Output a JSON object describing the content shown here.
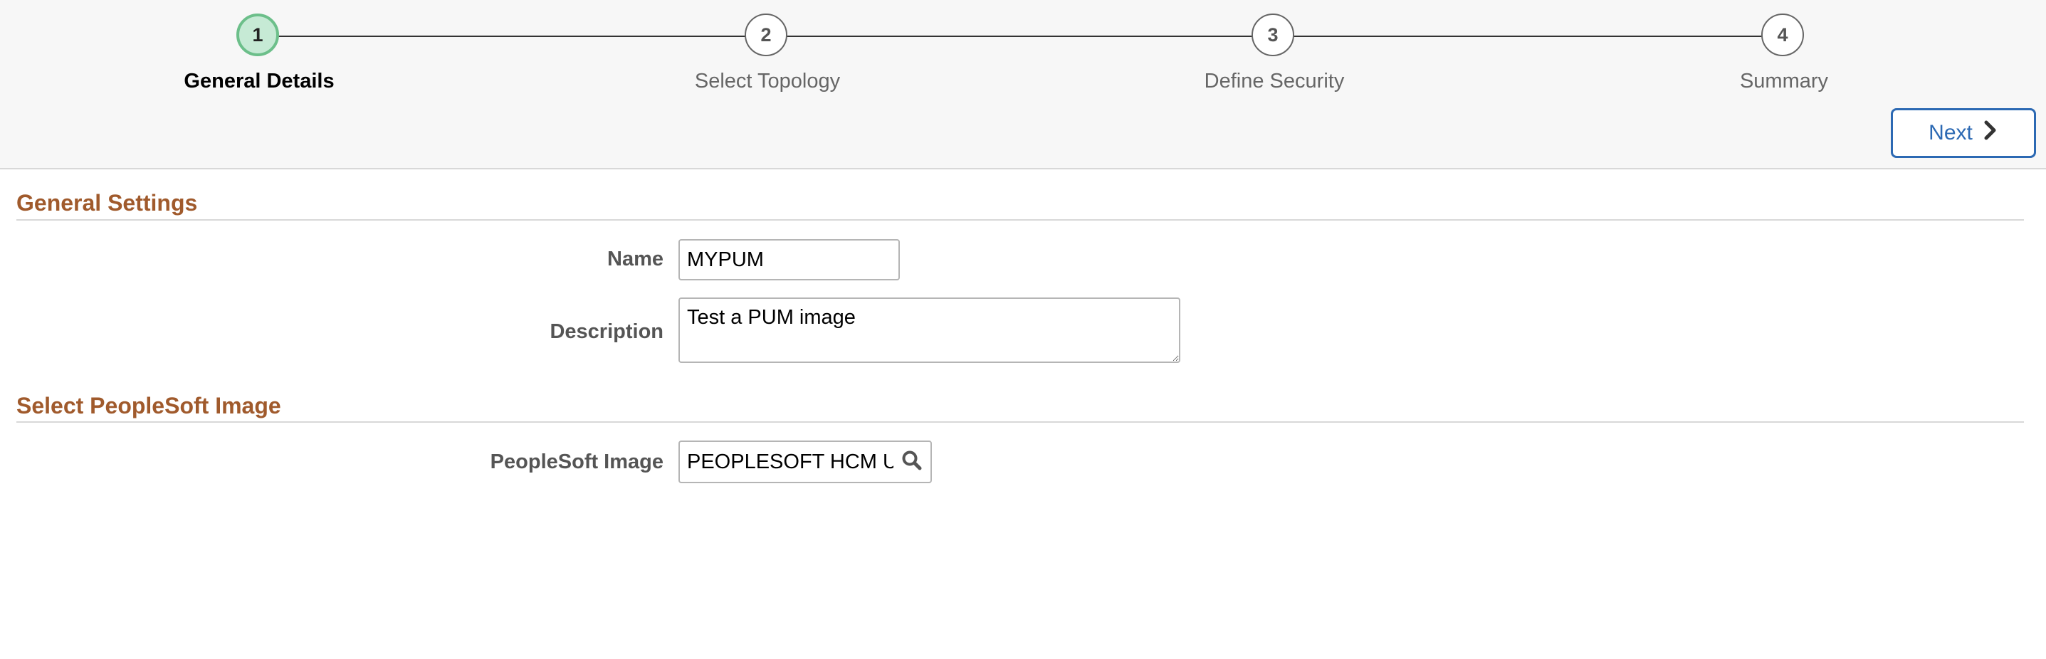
{
  "train": {
    "steps": [
      {
        "number": "1",
        "label": "General Details",
        "state": "active"
      },
      {
        "number": "2",
        "label": "Select Topology",
        "state": "inactive"
      },
      {
        "number": "3",
        "label": "Define Security",
        "state": "inactive"
      },
      {
        "number": "4",
        "label": "Summary",
        "state": "inactive"
      }
    ]
  },
  "toolbar": {
    "next_label": "Next",
    "next_icon": "chevron-right-icon"
  },
  "general_settings": {
    "title": "General Settings",
    "name_label": "Name",
    "name_value": "MYPUM",
    "description_label": "Description",
    "description_value": "Test a PUM image"
  },
  "image_section": {
    "title": "Select PeopleSoft Image",
    "image_label": "PeopleSoft Image",
    "image_value": "PEOPLESOFT HCM UPDATE IMAGE",
    "lookup_icon": "search-icon"
  },
  "colors": {
    "accent_blue": "#2c69b3",
    "section_title_brown": "#a05a2c",
    "active_step_fill": "#c6ead5",
    "active_step_border": "#6cbf8a"
  }
}
